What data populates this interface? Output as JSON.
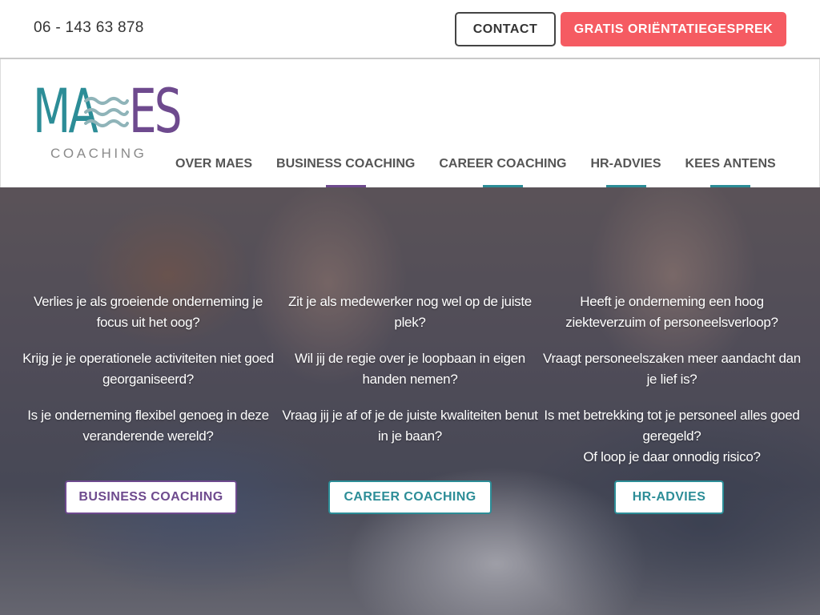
{
  "topbar": {
    "phone": "06 - 143 63 878",
    "contact_label": "CONTACT",
    "cta_label": "GRATIS ORIËNTATIEGESPREK"
  },
  "logo": {
    "left_letters": "MA",
    "right_letters": "ES",
    "subtitle": "COACHING"
  },
  "nav": {
    "items": [
      {
        "label": "OVER MAES"
      },
      {
        "label": "BUSINESS COACHING",
        "underline_color": "#6e4a8e"
      },
      {
        "label": "CAREER COACHING",
        "underline_color": "#2c8d97"
      },
      {
        "label": "HR-ADVIES",
        "underline_color": "#2c8d97"
      },
      {
        "label": "KEES ANTENS",
        "underline_color": "#2c8d97"
      }
    ]
  },
  "hero": {
    "columns": [
      {
        "questions": [
          "Verlies je als groeiende onderneming je focus uit het oog?",
          "Krijg je je operationele activiteiten niet goed georganiseerd?",
          "Is je onderneming flexibel genoeg in deze veranderende wereld?"
        ],
        "button_label": "BUSINESS COACHING"
      },
      {
        "questions": [
          "Zit je als medewerker nog wel op de juiste plek?",
          "Wil jij de regie over je loopbaan in eigen handen nemen?",
          "Vraag jij je af of je de juiste kwaliteiten benut in je baan?"
        ],
        "button_label": "CAREER COACHING"
      },
      {
        "questions": [
          "Heeft je onderneming een hoog ziekteverzuim of personeelsverloop?",
          "Vraagt personeelszaken meer aandacht dan je lief is?",
          "Is met betrekking tot je personeel alles goed geregeld?",
          "Of loop je daar onnodig risico?"
        ],
        "button_label": "HR-ADVIES"
      }
    ]
  },
  "colors": {
    "accent_red": "#f55b62",
    "brand_teal": "#2c8d97",
    "brand_purple": "#6e4a8e"
  }
}
